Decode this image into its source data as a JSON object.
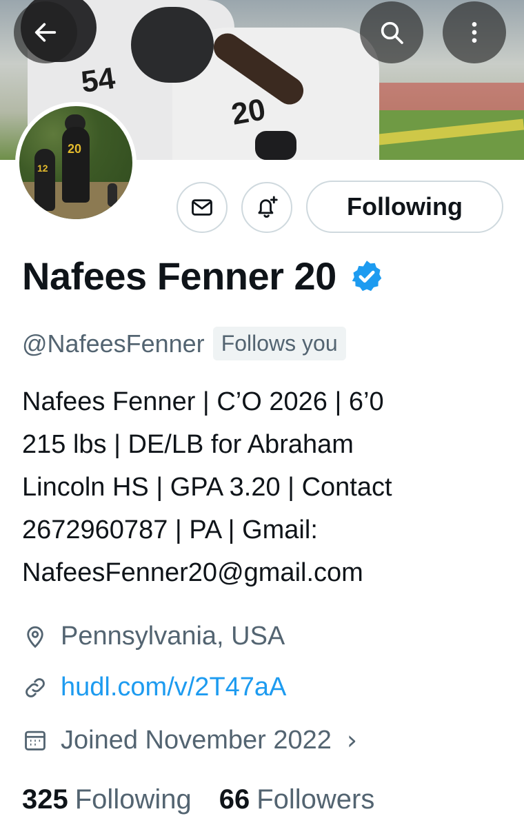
{
  "header": {
    "back_icon": "arrow-left-icon",
    "search_icon": "search-icon",
    "more_icon": "more-vertical-icon",
    "banner_numbers": [
      "54",
      "20"
    ]
  },
  "avatar": {
    "jersey_numbers": [
      "20",
      "12"
    ]
  },
  "actions": {
    "message_icon": "envelope-icon",
    "notify_icon": "bell-plus-icon",
    "follow_label": "Following"
  },
  "profile": {
    "display_name": "Nafees Fenner 20",
    "verified_icon": "verified-badge-icon",
    "handle": "@NafeesFenner",
    "follows_you": "Follows you",
    "bio_lines": [
      "Nafees Fenner | C’O 2026 | 6’0",
      "215 lbs | DE/LB for Abraham",
      "Lincoln HS | GPA 3.20 | Contact",
      "2672960787 | PA | Gmail:",
      "NafeesFenner20@gmail.com"
    ],
    "location": "Pennsylvania, USA",
    "website": "hudl.com/v/2T47aA",
    "joined": "Joined November 2022"
  },
  "stats": {
    "following_count": "325",
    "following_label": "Following",
    "followers_count": "66",
    "followers_label": "Followers"
  },
  "colors": {
    "accent": "#1d9bf0",
    "secondary_text": "#536471",
    "border": "#cfd9de"
  }
}
